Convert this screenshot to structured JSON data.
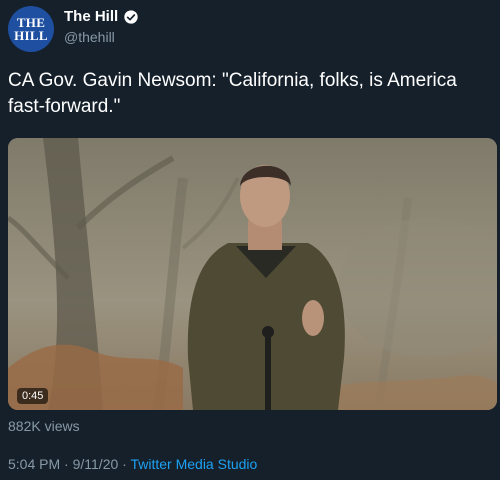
{
  "account": {
    "avatar_line1": "THE",
    "avatar_line2": "HILL",
    "display_name": "The Hill",
    "handle": "@thehill",
    "verified": true
  },
  "tweet": {
    "text": "CA Gov. Gavin Newsom: \"California, folks, is America fast-forward.\"",
    "views": "882K views",
    "time": "5:04 PM",
    "separator1": " · ",
    "date": "9/11/20",
    "separator2": " · ",
    "source": "Twitter Media Studio"
  },
  "video": {
    "duration": "0:45"
  },
  "colors": {
    "background": "#15202b",
    "secondary_text": "#8899a6",
    "link": "#1da1f2",
    "avatar": "#1e4fa0"
  }
}
